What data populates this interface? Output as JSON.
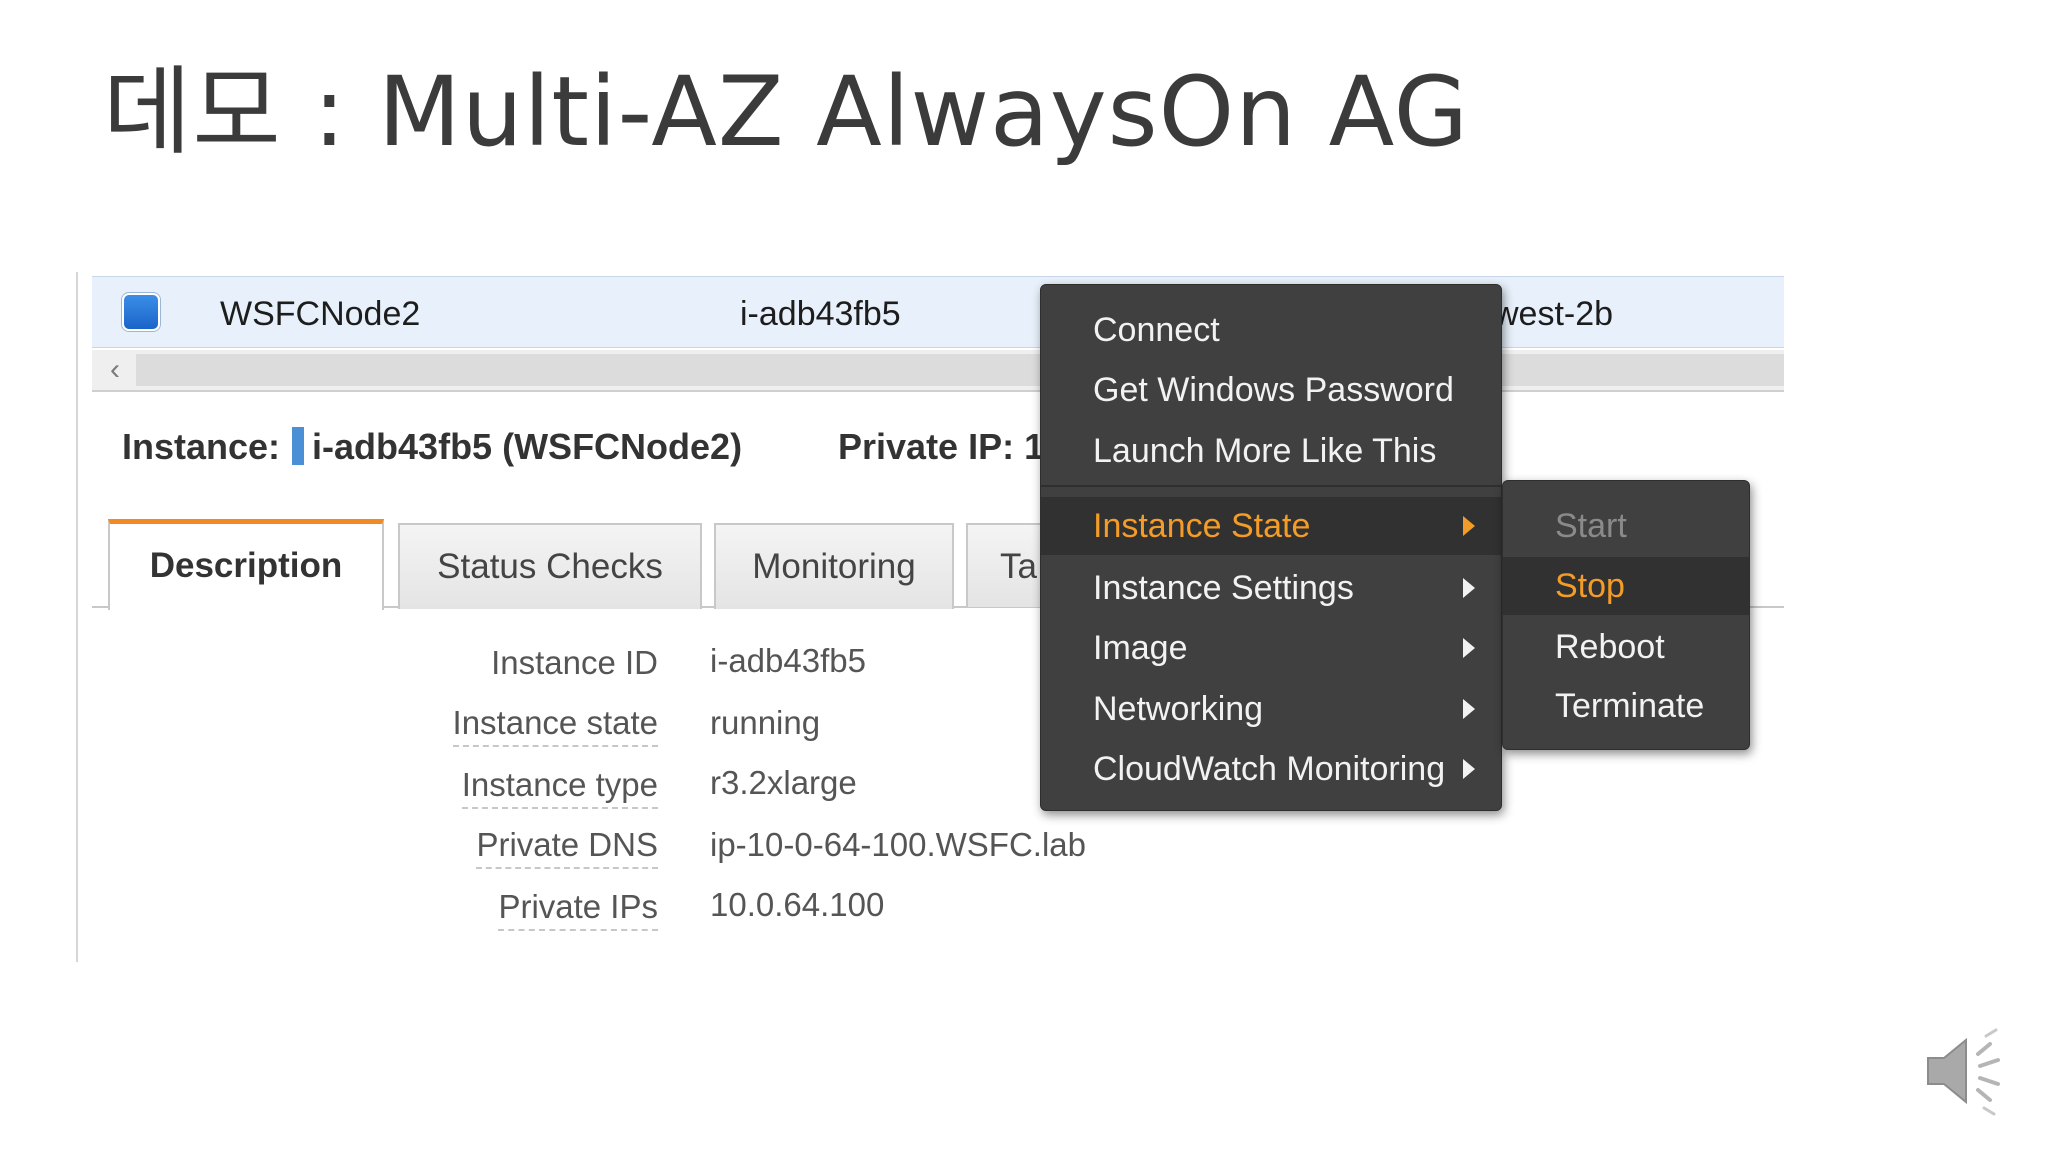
{
  "slide": {
    "title": "데모 : Multi-AZ AlwaysOn AG"
  },
  "instance_row": {
    "name": "WSFCNode2",
    "instance_id": "i-adb43fb5",
    "zone_partial": "west-2b"
  },
  "detail_header": {
    "instance_label": "Instance:",
    "instance_value": "i-adb43fb5 (WSFCNode2)",
    "private_ip_label": "Private IP:",
    "private_ip_partial": "1"
  },
  "tabs": [
    {
      "label": "Description",
      "active": true
    },
    {
      "label": "Status Checks",
      "active": false
    },
    {
      "label": "Monitoring",
      "active": false
    },
    {
      "label": "Ta",
      "active": false
    }
  ],
  "description": [
    {
      "label": "Instance ID",
      "value": "i-adb43fb5"
    },
    {
      "label": "Instance state",
      "value": "running"
    },
    {
      "label": "Instance type",
      "value": "r3.2xlarge"
    },
    {
      "label": "Private DNS",
      "value": "ip-10-0-64-100.WSFC.lab"
    },
    {
      "label": "Private IPs",
      "value": "10.0.64.100"
    }
  ],
  "context_menu": {
    "items": [
      {
        "label": "Connect"
      },
      {
        "label": "Get Windows Password"
      },
      {
        "label": "Launch More Like This"
      },
      {
        "label": "Instance State",
        "highlighted": true,
        "submenu": true
      },
      {
        "label": "Instance Settings",
        "submenu": true
      },
      {
        "label": "Image",
        "submenu": true
      },
      {
        "label": "Networking",
        "submenu": true
      },
      {
        "label": "CloudWatch Monitoring",
        "submenu": true
      }
    ]
  },
  "sub_menu": {
    "items": [
      {
        "label": "Start",
        "disabled": true
      },
      {
        "label": "Stop",
        "highlighted": true
      },
      {
        "label": "Reboot"
      },
      {
        "label": "Terminate"
      }
    ]
  },
  "colors": {
    "accent_orange": "#f39c27",
    "menu_bg": "#404040",
    "row_bg": "#e8f1fb",
    "checkbox_blue": "#1a64c9"
  },
  "icons": {
    "speaker": "speaker-icon"
  }
}
